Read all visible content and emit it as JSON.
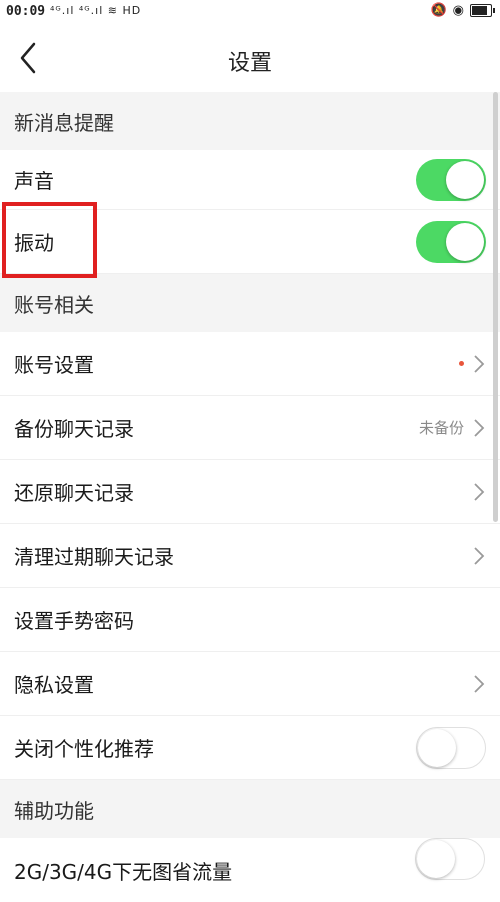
{
  "status": {
    "time": "00:09",
    "left_indicators": "⁴ᴳ.ıl ⁴ᴳ.ıl",
    "hd": "HD"
  },
  "nav": {
    "title": "设置"
  },
  "sections": {
    "notify": "新消息提醒",
    "account": "账号相关",
    "assist": "辅助功能"
  },
  "rows": {
    "sound": {
      "label": "声音",
      "on": true
    },
    "vibrate": {
      "label": "振动",
      "on": true
    },
    "account_settings": {
      "label": "账号设置"
    },
    "backup": {
      "label": "备份聊天记录",
      "sub": "未备份"
    },
    "restore": {
      "label": "还原聊天记录"
    },
    "clean": {
      "label": "清理过期聊天记录"
    },
    "gesture": {
      "label": "设置手势密码"
    },
    "privacy": {
      "label": "隐私设置"
    },
    "personalize": {
      "label": "关闭个性化推荐",
      "on": false
    },
    "data_saver": {
      "label": "2G/3G/4G下无图省流量",
      "on": false
    }
  },
  "colors": {
    "toggle_on": "#4cd964",
    "highlight": "#e02020",
    "badge_dot": "#e8553b"
  }
}
